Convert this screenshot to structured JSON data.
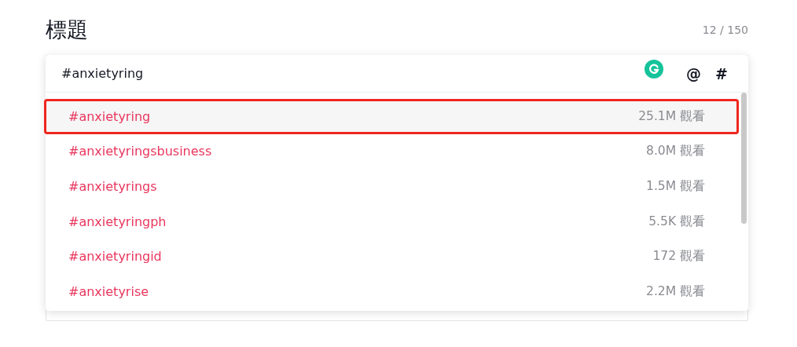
{
  "title": "標題",
  "counter": "12 / 150",
  "input": {
    "value": "#anxietyring",
    "buttons": [
      "@",
      "#"
    ]
  },
  "suggestions": [
    {
      "tag": "#anxietyring",
      "views": "25.1M 觀看",
      "selected": true
    },
    {
      "tag": "#anxietyringsbusiness",
      "views": "8.0M 觀看",
      "selected": false
    },
    {
      "tag": "#anxietyrings",
      "views": "1.5M 觀看",
      "selected": false
    },
    {
      "tag": "#anxietyringph",
      "views": "5.5K 觀看",
      "selected": false
    },
    {
      "tag": "#anxietyringid",
      "views": "172 觀看",
      "selected": false
    },
    {
      "tag": "#anxietyrise",
      "views": "2.2M 觀看",
      "selected": false
    }
  ]
}
